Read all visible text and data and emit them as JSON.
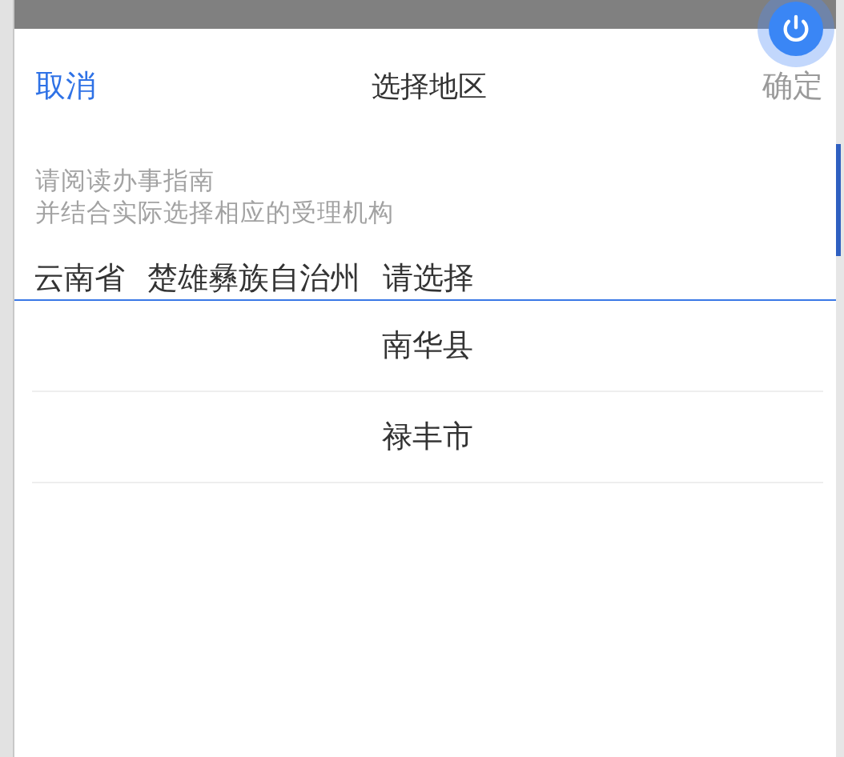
{
  "header": {
    "cancel": "取消",
    "title": "选择地区",
    "confirm": "确定"
  },
  "notice": [
    "请阅读办事指南",
    "并结合实际选择相应的受理机构"
  ],
  "tabs": [
    "云南省",
    "楚雄彝族自治州",
    "请选择"
  ],
  "options": [
    "南华县",
    "禄丰市"
  ]
}
